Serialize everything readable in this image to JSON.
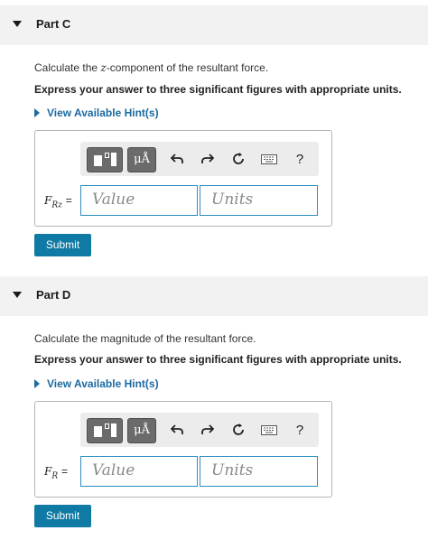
{
  "parts": [
    {
      "title": "Part C",
      "question_pre": "Calculate the ",
      "question_var": "z",
      "question_post": "-component of the resultant force.",
      "instruction": "Express your answer to three significant figures with appropriate units.",
      "hint_label": "View Available Hint(s)",
      "var_main": "F",
      "var_sub": "Rz",
      "eq": "=",
      "value_placeholder": "Value",
      "units_placeholder": "Units",
      "units_button": "μÅ",
      "help": "?",
      "submit_label": "Submit"
    },
    {
      "title": "Part D",
      "question_pre": "Calculate the magnitude of the resultant force.",
      "question_var": "",
      "question_post": "",
      "instruction": "Express your answer to three significant figures with appropriate units.",
      "hint_label": "View Available Hint(s)",
      "var_main": "F",
      "var_sub": "R",
      "eq": "=",
      "value_placeholder": "Value",
      "units_placeholder": "Units",
      "units_button": "μÅ",
      "help": "?",
      "submit_label": "Submit"
    }
  ],
  "icons": [
    "collapse-arrow-icon",
    "templates-icon",
    "undo-icon",
    "redo-icon",
    "reset-icon",
    "keyboard-icon",
    "help-icon"
  ],
  "colors": {
    "accent": "#0f7aa4",
    "hint": "#1b6aa0",
    "field_border": "#2d8ec1",
    "header_bg": "#f2f2f2"
  }
}
